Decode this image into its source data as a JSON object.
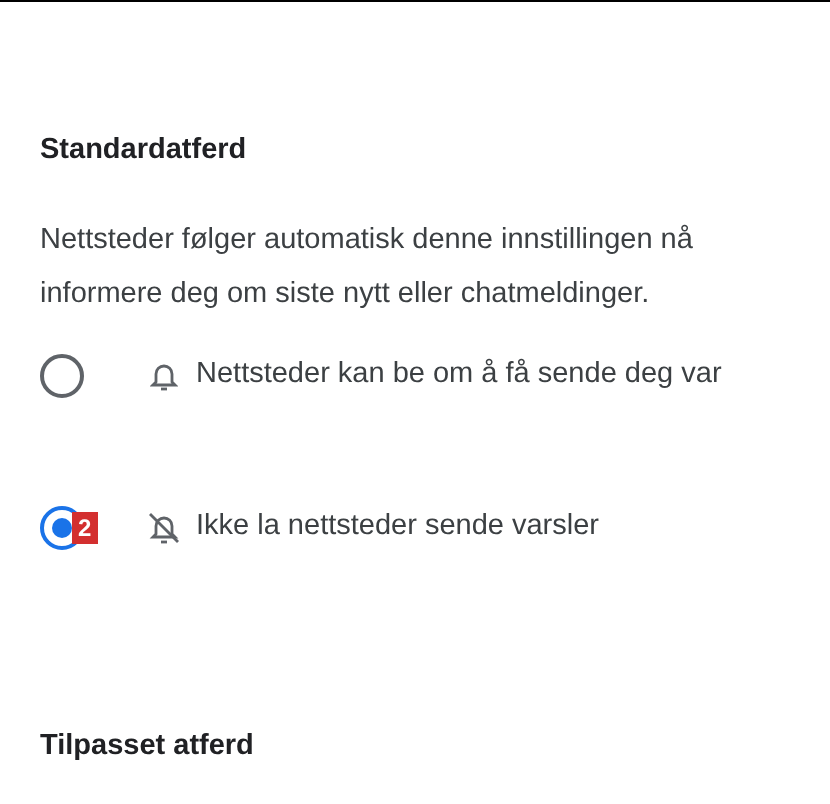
{
  "section_default": {
    "heading": "Standardatferd",
    "description_lines": [
      "Nettsteder følger automatisk denne innstillingen nå",
      "informere deg om siste nytt eller chatmeldinger."
    ],
    "options": [
      {
        "kind": "allow",
        "label": "Nettsteder kan be om å få sende deg var",
        "selected": false
      },
      {
        "kind": "block",
        "label": "Ikke la nettsteder sende varsler",
        "selected": true,
        "badge": "2"
      }
    ]
  },
  "section_custom": {
    "heading": "Tilpasset atferd"
  }
}
